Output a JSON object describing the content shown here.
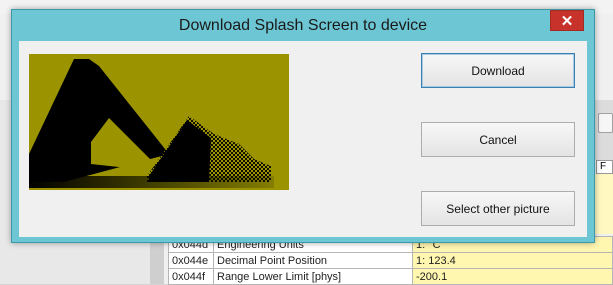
{
  "dialog": {
    "title": "Download Splash Screen to device",
    "close_glyph": "✕",
    "buttons": {
      "download": "Download",
      "cancel": "Cancel",
      "select_other": "Select other picture"
    },
    "preview_colors": {
      "background": "#9b9400",
      "foreground": "#000000"
    }
  },
  "background": {
    "right_column_header": "F",
    "table_rows": [
      {
        "addr": "0x044d",
        "name": "Engineering Units",
        "value": "1: °C"
      },
      {
        "addr": "0x044e",
        "name": "Decimal Point Position",
        "value": "1: 123.4"
      },
      {
        "addr": "0x044f",
        "name": "Range Lower Limit [phys]",
        "value": "-200.1"
      }
    ]
  },
  "colors": {
    "dialog_frame": "#6cc6d3",
    "close_button": "#c7332b",
    "value_cell": "#fff6b0"
  }
}
